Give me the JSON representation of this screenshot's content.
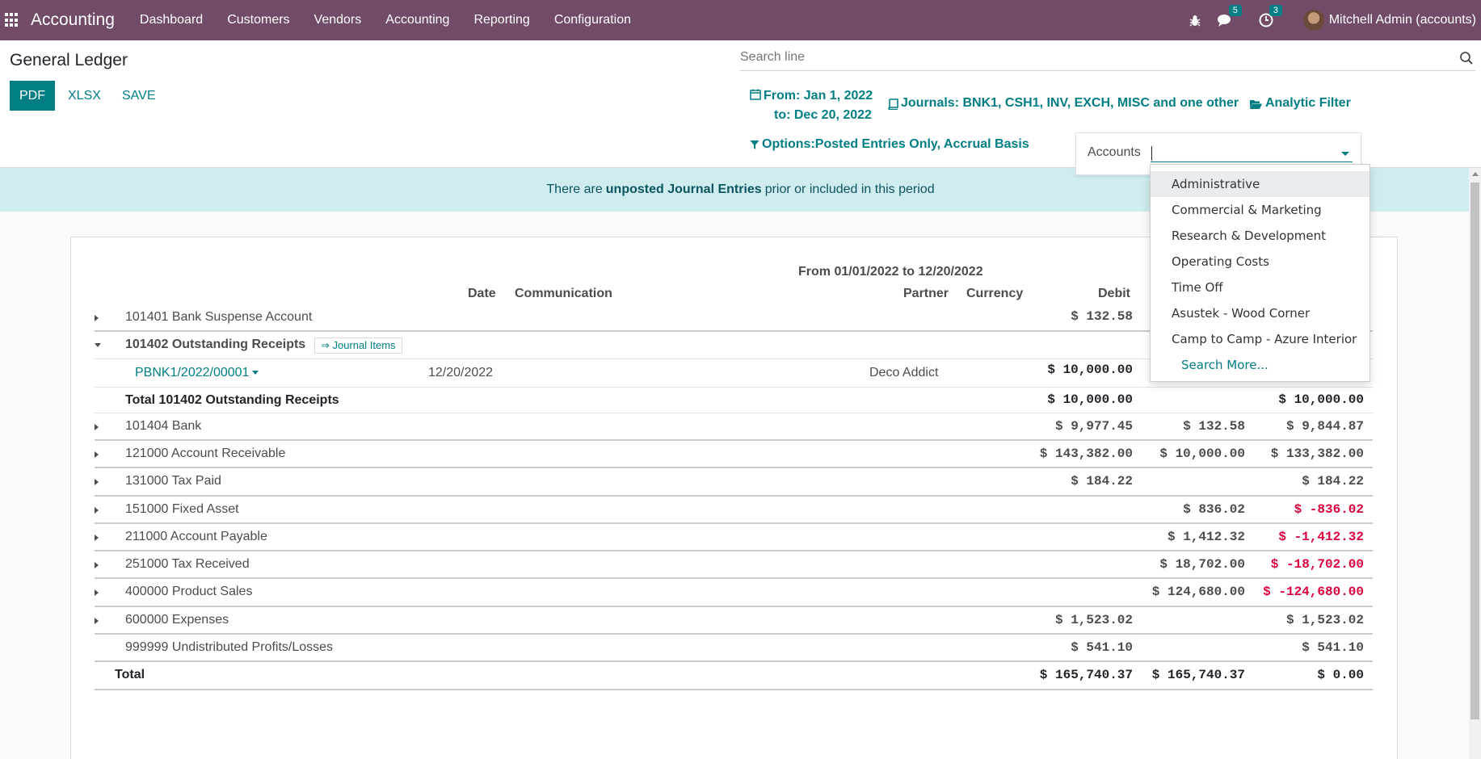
{
  "navbar": {
    "app_name": "Accounting",
    "menu": [
      "Dashboard",
      "Customers",
      "Vendors",
      "Accounting",
      "Reporting",
      "Configuration"
    ],
    "messages_badge": "5",
    "activities_badge": "3",
    "user": "Mitchell Admin (accounts)"
  },
  "control": {
    "title": "General Ledger",
    "pdf_label": "PDF",
    "xlsx_label": "XLSX",
    "save_label": "SAVE",
    "search_placeholder": "Search line",
    "date_from": "From: Jan 1, 2022",
    "date_to": "to: Dec 20, 2022",
    "journals": "Journals: BNK1, CSH1, INV, EXCH, MISC and one other",
    "analytic": "Analytic Filter",
    "options": "Options:Posted Entries Only, Accrual Basis",
    "accounts_label": "Accounts"
  },
  "dropdown": {
    "items": [
      "Administrative",
      "Commercial & Marketing",
      "Research & Development",
      "Operating Costs",
      "Time Off",
      "Asustek - Wood Corner",
      "Camp to Camp - Azure Interior"
    ],
    "search_more": "Search More..."
  },
  "alert": {
    "pre": "There are",
    "link": "unposted Journal Entries",
    "post": "prior or included in this period"
  },
  "report": {
    "period": "From 01/01/2022 to 12/20/2022",
    "headers": {
      "date": "Date",
      "communication": "Communication",
      "partner": "Partner",
      "currency": "Currency",
      "debit": "Debit"
    },
    "journal_items_label": "⇒ Journal Items",
    "rows": [
      {
        "name": "101401 Bank Suspense Account",
        "debit": "$ 132.58",
        "credit": "",
        "balance": ""
      },
      {
        "name": "101402 Outstanding Receipts",
        "debit": "",
        "credit": "",
        "balance": ""
      },
      {
        "entry": "PBNK1/2022/00001",
        "date": "12/20/2022",
        "partner": "Deco Addict",
        "debit": "$ 10,000.00"
      },
      {
        "name": "Total 101402 Outstanding Receipts",
        "debit": "$ 10,000.00",
        "credit": "",
        "balance": "$ 10,000.00"
      },
      {
        "name": "101404 Bank",
        "debit": "$ 9,977.45",
        "credit": "$ 132.58",
        "balance": "$ 9,844.87"
      },
      {
        "name": "121000 Account Receivable",
        "debit": "$ 143,382.00",
        "credit": "$ 10,000.00",
        "balance": "$ 133,382.00"
      },
      {
        "name": "131000 Tax Paid",
        "debit": "$ 184.22",
        "credit": "",
        "balance": "$ 184.22"
      },
      {
        "name": "151000 Fixed Asset",
        "debit": "",
        "credit": "$ 836.02",
        "balance": "$ -836.02"
      },
      {
        "name": "211000 Account Payable",
        "debit": "",
        "credit": "$ 1,412.32",
        "balance": "$ -1,412.32"
      },
      {
        "name": "251000 Tax Received",
        "debit": "",
        "credit": "$ 18,702.00",
        "balance": "$ -18,702.00"
      },
      {
        "name": "400000 Product Sales",
        "debit": "",
        "credit": "$ 124,680.00",
        "balance": "$ -124,680.00"
      },
      {
        "name": "600000 Expenses",
        "debit": "$ 1,523.02",
        "credit": "",
        "balance": "$ 1,523.02"
      },
      {
        "name": "999999 Undistributed Profits/Losses",
        "debit": "$ 541.10",
        "credit": "",
        "balance": "$ 541.10"
      }
    ],
    "total": {
      "name": "Total",
      "debit": "$ 165,740.37",
      "credit": "$ 165,740.37",
      "balance": "$ 0.00"
    }
  },
  "colors": {
    "navbar": "#714b67",
    "accent": "#017e84",
    "negative": "#d9003b",
    "alert_bg": "#cfecef"
  }
}
